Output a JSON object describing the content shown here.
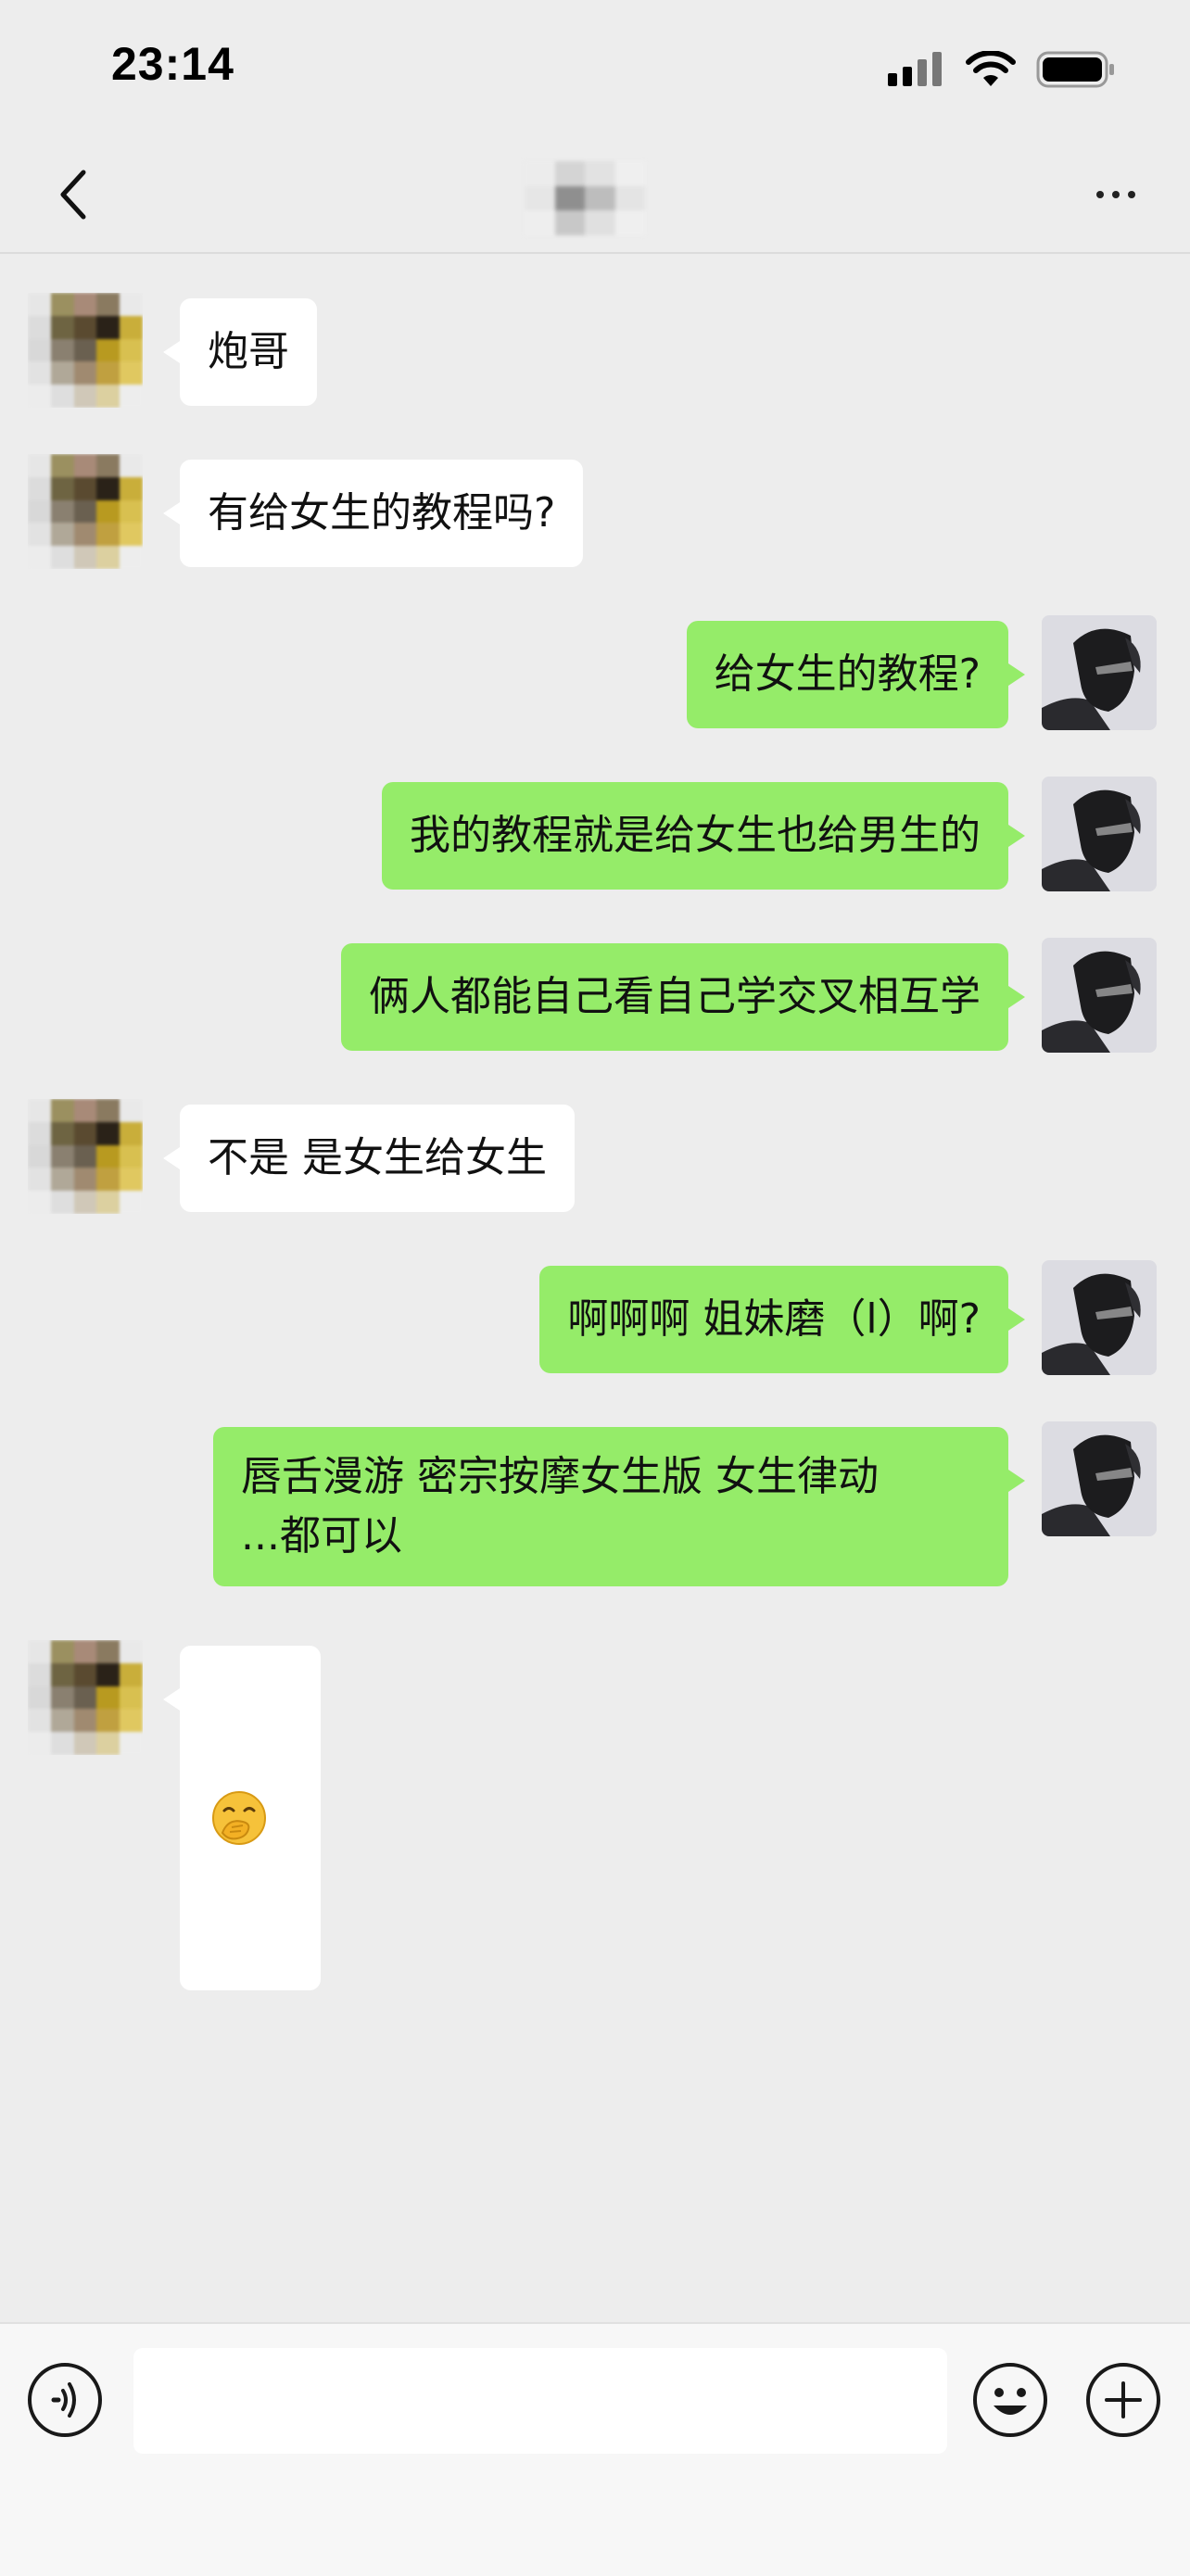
{
  "status_bar": {
    "time": "23:14",
    "icons": [
      "cellular-signal-icon",
      "wifi-icon",
      "battery-icon"
    ]
  },
  "nav": {
    "back_icon": "chevron-left-icon",
    "title": "",
    "more_icon": "more-icon"
  },
  "messages": [
    {
      "side": "left",
      "text": "炮哥"
    },
    {
      "side": "left",
      "text": "有给女生的教程吗?"
    },
    {
      "side": "right",
      "text": "给女生的教程?"
    },
    {
      "side": "right",
      "text": "我的教程就是给女生也给男生的"
    },
    {
      "side": "right",
      "text": "俩人都能自己看自己学交叉相互学"
    },
    {
      "side": "left",
      "text": "不是 是女生给女生"
    },
    {
      "side": "right",
      "text": "啊啊啊 姐妹磨（l）啊?"
    },
    {
      "side": "right",
      "text": "唇舌漫游 密宗按摩女生版 女生律动\n...都可以"
    },
    {
      "side": "left",
      "emoji": "hand-over-mouth-emoji"
    }
  ],
  "input": {
    "voice_icon": "voice-icon",
    "value": "",
    "emoji_icon": "emoji-icon",
    "add_icon": "plus-icon"
  },
  "colors": {
    "background": "#ededed",
    "sent_bubble": "#95ec69",
    "received_bubble": "#ffffff",
    "input_bar": "#f7f7f7"
  }
}
